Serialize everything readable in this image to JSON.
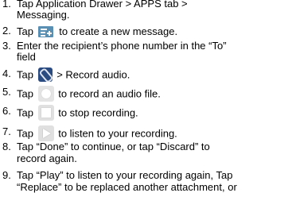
{
  "colors": {
    "text": "#000000",
    "new_message_icon": "#5a8fb4",
    "attach_icon": "#2a4a82",
    "button_icon_bg": "#e0e0e0"
  },
  "icons": {
    "new_message": "new-message-icon",
    "attach": "paperclip-icon",
    "record": "record-icon",
    "stop": "stop-icon",
    "play": "play-icon"
  },
  "steps": [
    {
      "num": "1.",
      "line1": "Tap Application Drawer > APPS tab >",
      "line2": "Messaging."
    },
    {
      "num": "2.",
      "before": "Tap",
      "after": "to create a new message."
    },
    {
      "num": "3.",
      "line1": "Enter the recipient’s phone number in the “To”",
      "line2": "field"
    },
    {
      "num": "4.",
      "before": "Tap",
      "after": "> Record audio."
    },
    {
      "num": "5.",
      "before": "Tap",
      "after": "to record an audio file."
    },
    {
      "num": "6.",
      "before": "Tap",
      "after": "to stop recording."
    },
    {
      "num": "7.",
      "before": "Tap",
      "after": "to listen to your recording."
    },
    {
      "num": "8.",
      "line1": "Tap “Done” to continue, or tap “Discard” to",
      "line2": "record again."
    },
    {
      "num": "9.",
      "line1": "Tap “Play” to listen to your recording again, Tap",
      "line2": "“Replace” to be replaced another attachment, or"
    }
  ]
}
